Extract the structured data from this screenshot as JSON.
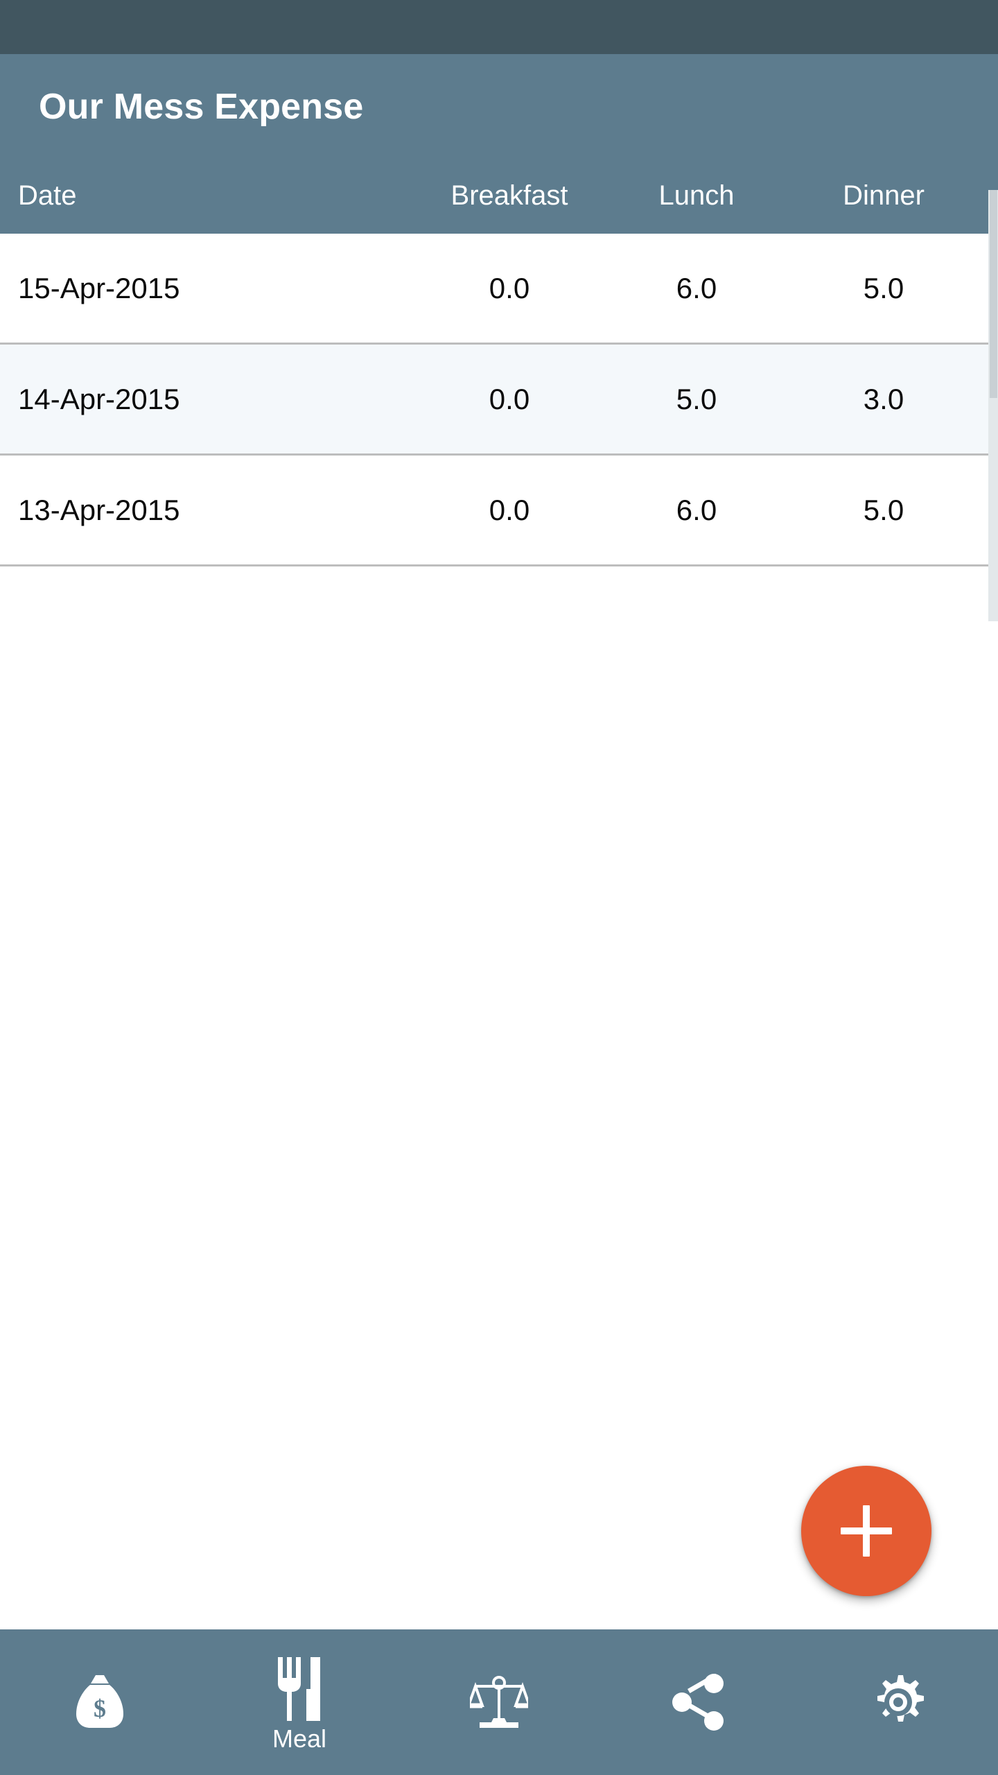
{
  "app": {
    "title": "Our Mess Expense"
  },
  "colors": {
    "status_bar": "#415660",
    "header": "#5D7C8E",
    "accent_fab": "#E55B32",
    "row_alt": "#F4F8FB",
    "row_default": "#FFFFFF",
    "divider": "#BDBDBD",
    "text_primary": "#0A0A0A",
    "text_on_header": "#FFFFFF"
  },
  "table": {
    "columns": [
      {
        "key": "date",
        "label": "Date",
        "align": "left"
      },
      {
        "key": "breakfast",
        "label": "Breakfast",
        "align": "center"
      },
      {
        "key": "lunch",
        "label": "Lunch",
        "align": "center"
      },
      {
        "key": "dinner",
        "label": "Dinner",
        "align": "center"
      },
      {
        "key": "clipped",
        "label": "",
        "align": "center"
      }
    ],
    "rows": [
      {
        "date": "15-Apr-2015",
        "breakfast": "0.0",
        "lunch": "6.0",
        "dinner": "5.0",
        "clipped": ""
      },
      {
        "date": "14-Apr-2015",
        "breakfast": "0.0",
        "lunch": "5.0",
        "dinner": "3.0",
        "clipped": ""
      },
      {
        "date": "13-Apr-2015",
        "breakfast": "0.0",
        "lunch": "6.0",
        "dinner": "5.0",
        "clipped": ""
      }
    ]
  },
  "fab": {
    "icon": "plus-icon",
    "label": "+"
  },
  "bottom_nav": {
    "items": [
      {
        "icon": "money-bag-icon",
        "label": "",
        "active": false
      },
      {
        "icon": "fork-knife-icon",
        "label": "Meal",
        "active": true
      },
      {
        "icon": "balance-scale-icon",
        "label": "",
        "active": false
      },
      {
        "icon": "share-icon",
        "label": "",
        "active": false
      },
      {
        "icon": "gear-icon",
        "label": "",
        "active": false
      }
    ]
  }
}
